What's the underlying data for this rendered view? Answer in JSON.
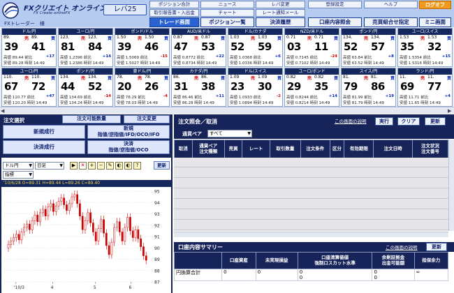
{
  "header": {
    "logo_text": "FXクリエイト オンラインFX",
    "logo_subtext": "FX Create onlineFX",
    "user_label": "FXトレーダー　様",
    "leverage": "レバ25",
    "top_links_row1": [
      "ポジション合計",
      "ニュース",
      "レバ変更",
      "登録設定",
      "ヘルプ"
    ],
    "top_links_row2": [
      "取引報告書・入出金",
      "チャート",
      "レート通知メール"
    ],
    "logoff": "ログオフ",
    "main_tabs": [
      "トレード画面",
      "ポジション一覧",
      "決済履歴",
      "口座内容照会",
      "売買組合せ指定",
      "ミニ画面"
    ]
  },
  "rates": [
    {
      "pair": "ドル/円",
      "bid_small": "89.",
      "spread": "売",
      "ask_small": "89.",
      "bid_big": "39",
      "ask_big": "41",
      "high_label": "高値",
      "high": "89.44",
      "low_label": "安値",
      "low": "89.28",
      "chg_label": "前比",
      "chg": "+17",
      "time": "時刻 14:49",
      "dir": "up"
    },
    {
      "pair": "ユーロ/円",
      "bid_small": "123.",
      "spread": "売",
      "ask_small": "123.",
      "bid_big": "81",
      "ask_big": "84",
      "high_label": "高値",
      "high": "1.2396",
      "low_label": "安値",
      "low": "1.2386",
      "chg_label": "前比",
      "chg": "+14",
      "time": "時刻 14:49",
      "dir": "up"
    },
    {
      "pair": "ポンド/ドル",
      "bid_small": "1.50",
      "spread": "売",
      "ask_small": "1.50",
      "bid_big": "39",
      "ask_big": "46",
      "high_label": "高値",
      "high": "1.5069",
      "low_label": "安値",
      "low": "1.5027",
      "chg_label": "前比",
      "chg": "-15",
      "time": "時刻 14:49",
      "dir": "dn"
    },
    {
      "pair": "AUD/米ドル",
      "bid_small": "0.87",
      "spread": "売",
      "ask_small": "0.87",
      "bid_big": "47",
      "ask_big": "53",
      "high_label": "高値",
      "high": "0.8772",
      "low_label": "安値",
      "low": "0.8734",
      "chg_label": "前比",
      "chg": "+22",
      "time": "時刻 14:49",
      "dir": "up"
    },
    {
      "pair": "ドル/カナダ",
      "bid_small": "1.03",
      "spread": "売",
      "ask_small": "1.03",
      "bid_big": "52",
      "ask_big": "59",
      "high_label": "高値",
      "high": "1.0368",
      "low_label": "安値",
      "low": "1.0336",
      "chg_label": "前比",
      "chg": "+6",
      "time": "時刻 14:49",
      "dir": "up"
    },
    {
      "pair": "NZD/米ドル",
      "bid_small": "0.71",
      "spread": "売",
      "ask_small": "0.71",
      "bid_big": "03",
      "ask_big": "11",
      "high_label": "高値",
      "high": "0.7145",
      "low_label": "安値",
      "low": "0.7102",
      "chg_label": "前比",
      "chg": "-24",
      "time": "時刻 14:49",
      "dir": "dn"
    },
    {
      "pair": "ポンド/円",
      "bid_small": "134.",
      "spread": "売",
      "ask_small": "134.",
      "bid_big": "52",
      "ask_big": "57",
      "high_label": "高値",
      "high": "63.84",
      "low_label": "安値",
      "low": "63.52",
      "chg_label": "前比",
      "chg": "+8",
      "time": "時刻 14:49",
      "dir": "up"
    },
    {
      "pair": "ユーロ/スイス",
      "bid_small": "1.53",
      "spread": "売",
      "ask_small": "1.53",
      "bid_big": "35",
      "ask_big": "32",
      "high_label": "高値",
      "high": "1.5354",
      "low_label": "安値",
      "low": "1.5316",
      "chg_label": "前比",
      "chg": "+15",
      "time": "時刻 14:49",
      "dir": "up"
    },
    {
      "pair": "ユーロ/円",
      "bid_small": "110.",
      "spread": "売",
      "ask_small": "110.",
      "bid_big": "67",
      "ask_big": "72",
      "high_label": "高値",
      "high": "110.77",
      "low_label": "安値",
      "low": "110.20",
      "chg_label": "前比",
      "chg": "+47",
      "time": "時刻 14:49",
      "dir": "up"
    },
    {
      "pair": "ポンド/円",
      "bid_small": "134.",
      "spread": "売",
      "ask_small": "134.",
      "bid_big": "44",
      "ask_big": "52",
      "high_label": "高値",
      "high": "134.69",
      "low_label": "安値",
      "low": "134.24",
      "chg_label": "前比",
      "chg": "-14",
      "time": "時刻 14:49",
      "dir": "dn"
    },
    {
      "pair": "豪ドル/円",
      "bid_small": "78.",
      "spread": "売",
      "ask_small": "78.",
      "bid_big": "20",
      "ask_big": "26",
      "high_label": "高値",
      "high": "78.29",
      "low_label": "安値",
      "low": "78.03",
      "chg_label": "前比",
      "chg": "-4",
      "time": "時刻 14:49",
      "dir": "dn"
    },
    {
      "pair": "カナダ/円",
      "bid_small": "86.",
      "spread": "売",
      "ask_small": "86.",
      "bid_big": "31",
      "ask_big": "38",
      "high_label": "高値",
      "high": "86.46",
      "low_label": "安値",
      "low": "86.28",
      "chg_label": "前比",
      "chg": "+11",
      "time": "時刻 14:49",
      "dir": "up"
    },
    {
      "pair": "ドル/スイス",
      "bid_small": "1.09",
      "spread": "売",
      "ask_small": "1.09",
      "bid_big": "23",
      "ask_big": "30",
      "high_label": "高値",
      "high": "1.0933",
      "low_label": "安値",
      "low": "1.0894",
      "chg_label": "前比",
      "chg": "-2",
      "time": "時刻 14:49",
      "dir": "dn"
    },
    {
      "pair": "ユーロ/ポンド",
      "bid_small": "0.82",
      "spread": "売",
      "ask_small": "0.82",
      "bid_big": "29",
      "ask_big": "35",
      "high_label": "高値",
      "high": "0.8244",
      "low_label": "安値",
      "low": "0.8214",
      "chg_label": "前比",
      "chg": "+14",
      "time": "時刻 14:49",
      "dir": "up"
    },
    {
      "pair": "スイス/円",
      "bid_small": "81.",
      "spread": "売",
      "ask_small": "81.",
      "bid_big": "79",
      "ask_big": "86",
      "high_label": "高値",
      "high": "81.99",
      "low_label": "安値",
      "low": "81.79",
      "chg_label": "前比",
      "chg": "+19",
      "time": "時刻 14:49",
      "dir": "up"
    },
    {
      "pair": "ランド/円",
      "bid_small": "11.",
      "spread": "売",
      "ask_small": "11.",
      "bid_big": "69",
      "ask_big": "77",
      "high_label": "高値",
      "high": "11.71",
      "low_label": "安値",
      "low": "11.65",
      "chg_label": "前比",
      "chg": "+4",
      "time": "時刻 14:49",
      "dir": "up"
    }
  ],
  "buy_marker": "買",
  "left": {
    "order_title": "注文選択",
    "order_qty": "注文可能数量",
    "order_change": "注文変更",
    "new_market": "新規成行",
    "new_limit_l1": "新規",
    "new_limit_l2": "指値/逆指値/IFD/OCO/IFO",
    "settle_market": "決済成行",
    "settle_limit_l1": "決済",
    "settle_limit_l2": "指値/逆指値/OCO",
    "chart_pair": "ドル円",
    "chart_period": "日足",
    "chart_type": "指標",
    "refresh": "更新",
    "ohlc": "'10/6/28  O=89.31  H=89.44  L=89.26  C=89.40",
    "tools": [
      "▶",
      "✕",
      "+",
      "−",
      "✎",
      "◐",
      "?"
    ]
  },
  "chart_data": {
    "type": "candlestick",
    "title": "",
    "ylim": [
      87,
      95
    ],
    "y_ticks": [
      "95",
      "94",
      "93",
      "92",
      "91",
      "90",
      "89",
      "88",
      "87"
    ],
    "x_ticks": [
      "'10/3",
      "4",
      "5",
      "6"
    ],
    "values": [
      90.3,
      90.6,
      90.9,
      91.2,
      90.7,
      91.4,
      91.8,
      92.1,
      91.6,
      92.4,
      92.9,
      92.3,
      93.1,
      93.4,
      92.8,
      93.6,
      93.9,
      93.2,
      93.7,
      94.1,
      94.4,
      93.8,
      93.3,
      93.9,
      94.5,
      94.7,
      93.9,
      92.8,
      91.6,
      92.4,
      93.1,
      92.2,
      91.4,
      90.6,
      91.7,
      92.5,
      91.3,
      90.2,
      89.4,
      90.5,
      91.8,
      92.3,
      91.4,
      90.6,
      91.8,
      92.7,
      91.5,
      90.9,
      91.6,
      90.8,
      90.1,
      89.3,
      88.9
    ]
  },
  "orders": {
    "title": "注文照会／取消",
    "help_link": "この画面の説明",
    "execute": "実行",
    "clear": "クリア",
    "refresh": "更新",
    "filter_label": "通貨ペア",
    "filter_value": "すべて",
    "columns": [
      "取消",
      "通貨ペア\n注文種類",
      "売買",
      "レート",
      "取引数量",
      "注文条件",
      "区分",
      "有効期限",
      "注文日時",
      "注文状況\n注文番号"
    ]
  },
  "summary": {
    "title": "口座内容サマリー",
    "help_link": "この画面の説明",
    "refresh": "更新",
    "columns": [
      "",
      "口座資産",
      "未実現損益",
      "口座清算価値\n強制ロスカット水準",
      "余剰証拠金\n出金可能額",
      "担保余力"
    ],
    "row_label": "円換算合計",
    "values": [
      "0",
      "0",
      "0\n0",
      "0\n0",
      "∞"
    ]
  }
}
